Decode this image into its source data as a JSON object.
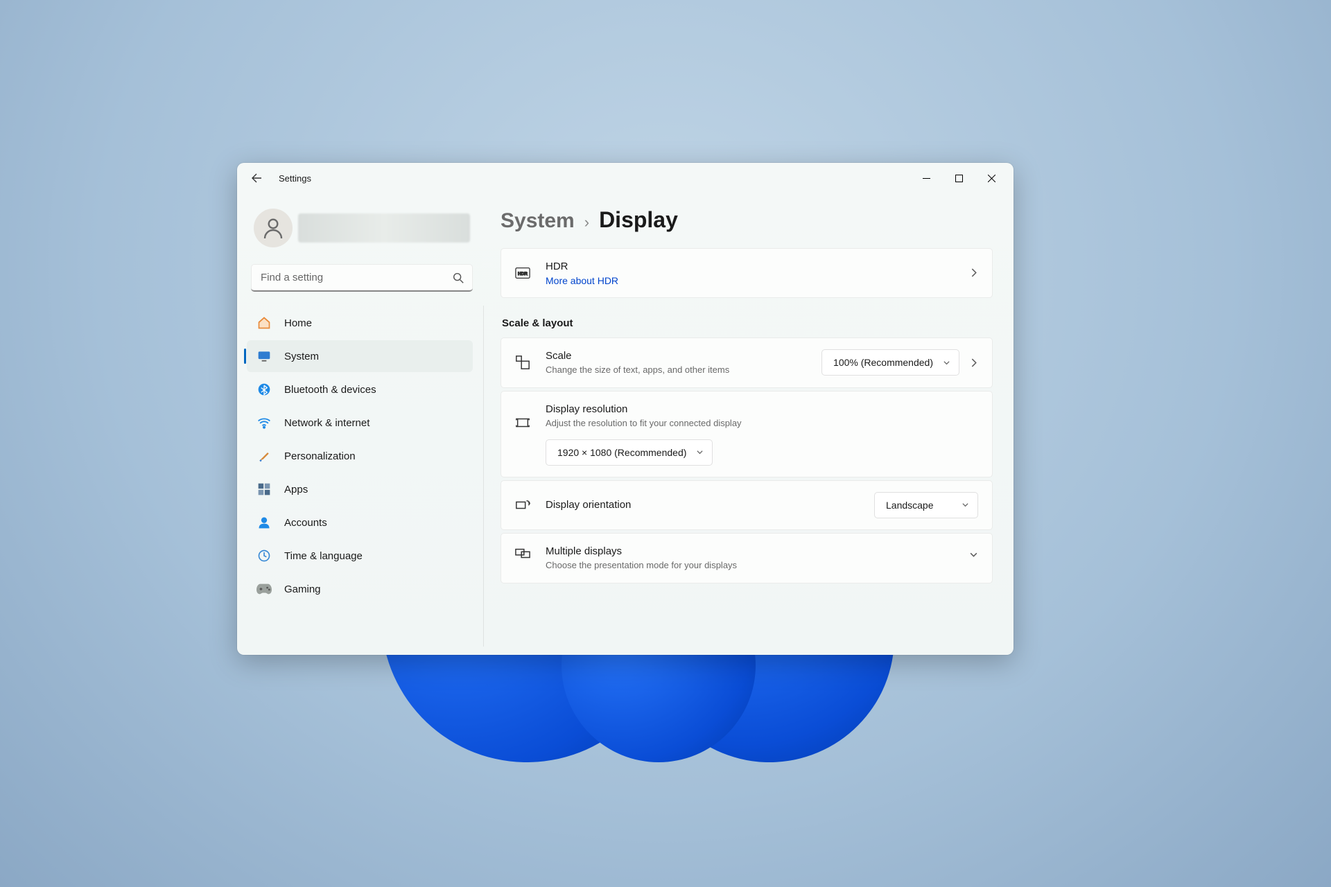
{
  "window": {
    "title": "Settings"
  },
  "search": {
    "placeholder": "Find a setting"
  },
  "sidebar": {
    "items": [
      {
        "label": "Home"
      },
      {
        "label": "System"
      },
      {
        "label": "Bluetooth & devices"
      },
      {
        "label": "Network & internet"
      },
      {
        "label": "Personalization"
      },
      {
        "label": "Apps"
      },
      {
        "label": "Accounts"
      },
      {
        "label": "Time & language"
      },
      {
        "label": "Gaming"
      }
    ]
  },
  "breadcrumb": {
    "parent": "System",
    "current": "Display"
  },
  "hdr": {
    "title": "HDR",
    "link": "More about HDR"
  },
  "section": {
    "scale_layout": "Scale & layout"
  },
  "scale": {
    "title": "Scale",
    "sub": "Change the size of text, apps, and other items",
    "value": "100% (Recommended)"
  },
  "resolution": {
    "title": "Display resolution",
    "sub": "Adjust the resolution to fit your connected display",
    "value": "1920 × 1080 (Recommended)"
  },
  "orientation": {
    "title": "Display orientation",
    "value": "Landscape"
  },
  "multi": {
    "title": "Multiple displays",
    "sub": "Choose the presentation mode for your displays"
  }
}
